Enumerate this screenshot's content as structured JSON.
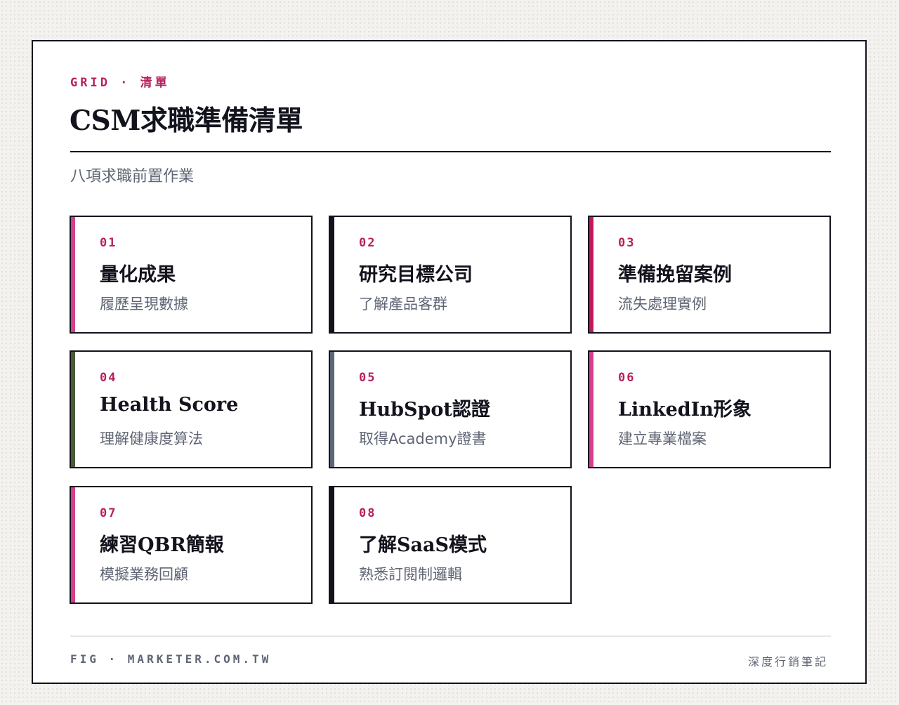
{
  "header": {
    "eyebrow": "GRID · 清單",
    "title": "CSM求職準備清單",
    "subtitle": "八項求職前置作業"
  },
  "cards": [
    {
      "num": "01",
      "title": "量化成果",
      "desc": "履歷呈現數據",
      "accent": "#d63f8c"
    },
    {
      "num": "02",
      "title": "研究目標公司",
      "desc": "了解產品客群",
      "accent": "#12131c"
    },
    {
      "num": "03",
      "title": "準備挽留案例",
      "desc": "流失處理實例",
      "accent": "#c2185b"
    },
    {
      "num": "04",
      "title": "Health Score",
      "desc": "理解健康度算法",
      "accent": "#4a5a3a"
    },
    {
      "num": "05",
      "title": "HubSpot認證",
      "desc": "取得Academy證書",
      "accent": "#5d6578"
    },
    {
      "num": "06",
      "title": "LinkedIn形象",
      "desc": "建立專業檔案",
      "accent": "#d63f8c"
    },
    {
      "num": "07",
      "title": "練習QBR簡報",
      "desc": "模擬業務回顧",
      "accent": "#d63f8c"
    },
    {
      "num": "08",
      "title": "了解SaaS模式",
      "desc": "熟悉訂閱制邏輯",
      "accent": "#12131c"
    }
  ],
  "footer": {
    "left": "FIG · MARKETER.COM.TW",
    "right": "深度行銷筆記"
  },
  "colors": {
    "accent_text": "#b6215f",
    "ink": "#12131c",
    "muted": "#5f6574"
  }
}
